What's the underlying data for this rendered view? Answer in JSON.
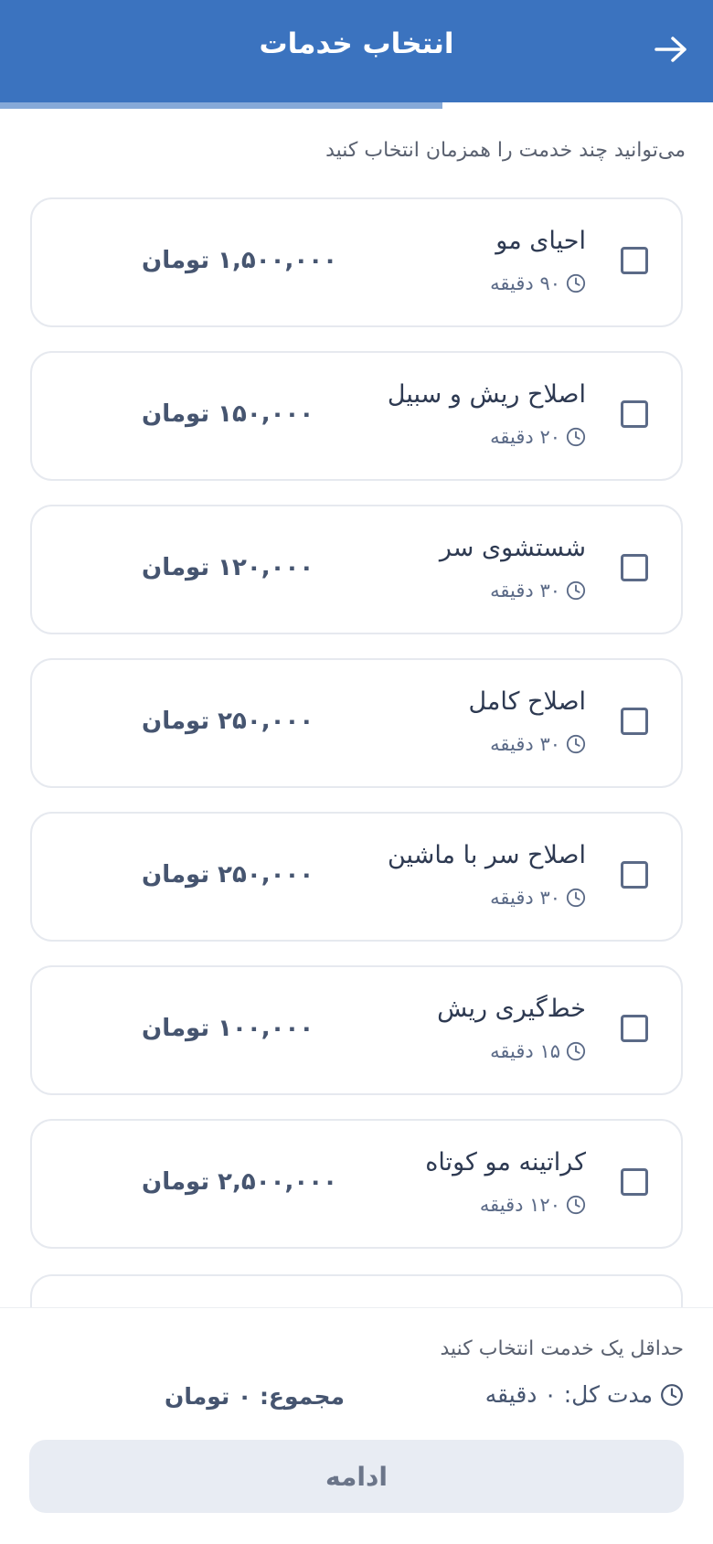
{
  "header": {
    "title": "انتخاب خدمات"
  },
  "progress": {
    "fraction": 0.62
  },
  "hint": "می‌توانید چند خدمت را همزمان انتخاب کنید",
  "services": [
    {
      "name": "احیای مو",
      "duration": "۹۰ دقیقه",
      "price": "۱,۵۰۰,۰۰۰ تومان",
      "selected": false
    },
    {
      "name": "اصلاح ریش و سبیل",
      "duration": "۲۰ دقیقه",
      "price": "۱۵۰,۰۰۰ تومان",
      "selected": false
    },
    {
      "name": "شستشوی سر",
      "duration": "۳۰ دقیقه",
      "price": "۱۲۰,۰۰۰ تومان",
      "selected": false
    },
    {
      "name": "اصلاح کامل",
      "duration": "۳۰ دقیقه",
      "price": "۲۵۰,۰۰۰ تومان",
      "selected": false
    },
    {
      "name": "اصلاح سر با ماشین",
      "duration": "۳۰ دقیقه",
      "price": "۲۵۰,۰۰۰ تومان",
      "selected": false
    },
    {
      "name": "خط‌گیری ریش",
      "duration": "۱۵ دقیقه",
      "price": "۱۰۰,۰۰۰ تومان",
      "selected": false
    },
    {
      "name": "کراتینه مو کوتاه",
      "duration": "۱۲۰ دقیقه",
      "price": "۲,۵۰۰,۰۰۰ تومان",
      "selected": false
    }
  ],
  "footer": {
    "hint": "حداقل یک خدمت انتخاب کنید",
    "duration_label": "مدت کل: ۰ دقیقه",
    "total_label": "مجموع: ۰ تومان",
    "continue_label": "ادامه"
  },
  "icons": {
    "back": "arrow-right-icon",
    "clock": "clock-icon",
    "checkbox": "checkbox-empty-icon"
  },
  "colors": {
    "header_bg": "#3b73bf",
    "text_primary": "#2e3a52",
    "text_secondary": "#5b6a87",
    "button_disabled_bg": "#e8ecf3"
  }
}
